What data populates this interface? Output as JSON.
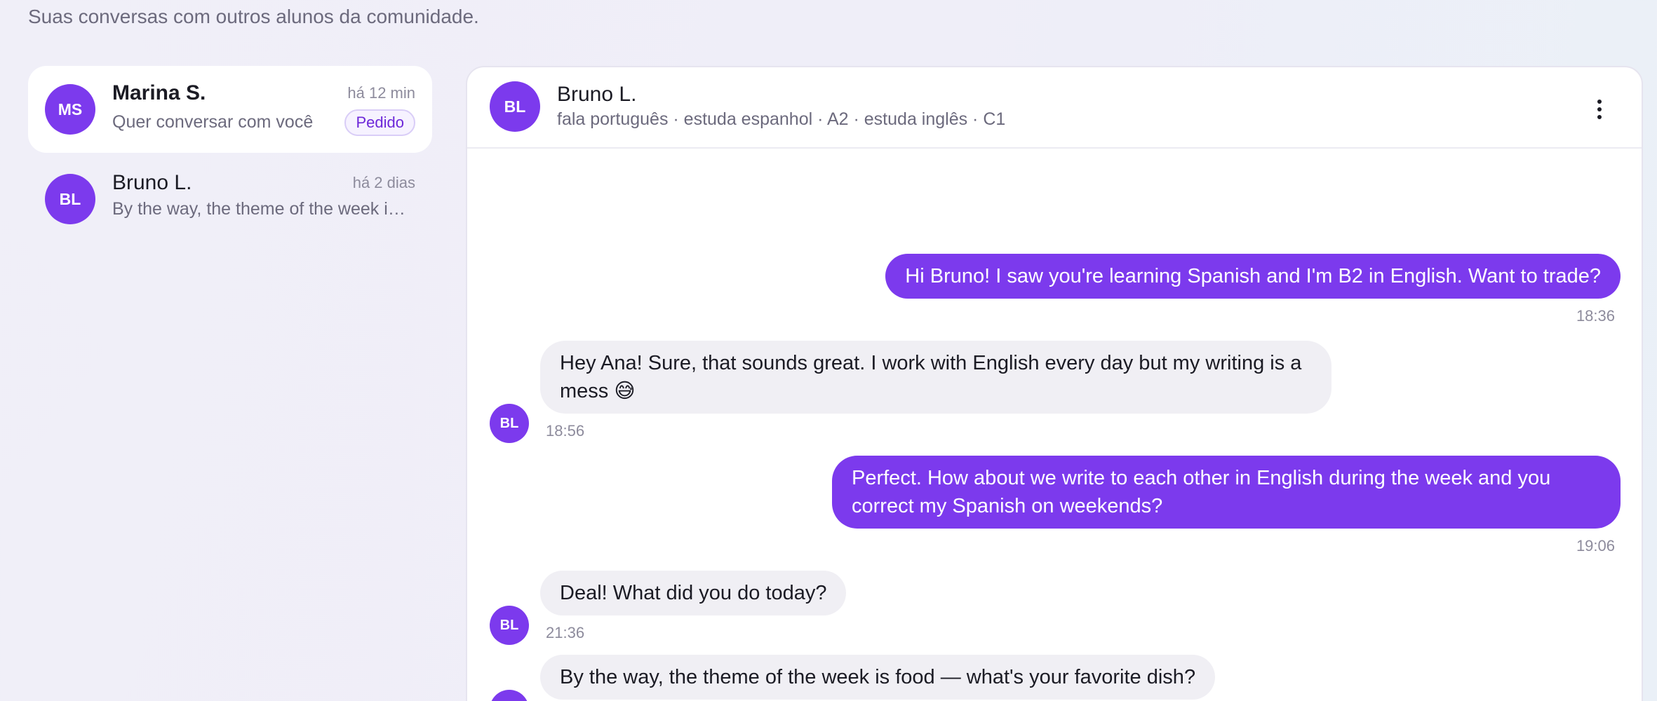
{
  "page": {
    "subtitle": "Suas conversas com outros alunos da comunidade."
  },
  "conversations": [
    {
      "initials": "MS",
      "name": "Marina S.",
      "time": "há 12 min",
      "preview": "Quer conversar com você",
      "badge": "Pedido",
      "active": true
    },
    {
      "initials": "BL",
      "name": "Bruno L.",
      "time": "há 2 dias",
      "preview": "By the way, the theme of the week is food — what's your favorite dish?",
      "active": false
    }
  ],
  "chat": {
    "initials": "BL",
    "name": "Bruno L.",
    "meta": "fala português · estuda espanhol · A2 · estuda inglês · C1",
    "menu_icon": "more-vertical-icon",
    "messages": [
      {
        "direction": "out",
        "text": "Hi Bruno! I saw you're learning Spanish and I'm B2 in English. Want to trade?",
        "time": "18:36"
      },
      {
        "direction": "in",
        "text": "Hey Ana! Sure, that sounds great. I work with English every day but my writing is a mess 😅",
        "time": "18:56",
        "avatar": "BL"
      },
      {
        "direction": "out",
        "text": "Perfect. How about we write to each other in English during the week and you correct my Spanish on weekends?",
        "time": "19:06"
      },
      {
        "direction": "in",
        "text": "Deal! What did you do today?",
        "time": "21:36",
        "avatar": "BL"
      },
      {
        "direction": "in",
        "text": "By the way, the theme of the week is food — what's your favorite dish?",
        "avatar": "BL"
      }
    ]
  },
  "colors": {
    "accent": "#7c3aed",
    "incoming_bubble": "#f0eff4",
    "badge_text": "#6d28d9"
  }
}
